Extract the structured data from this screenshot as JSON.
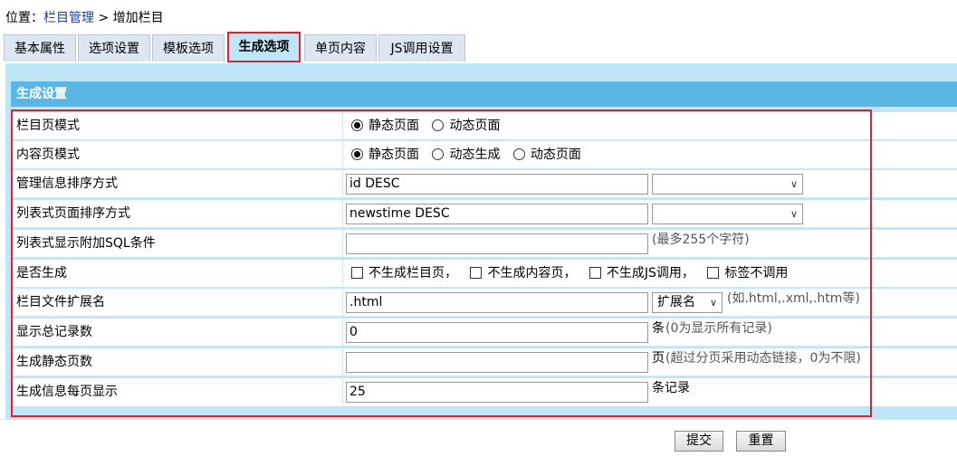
{
  "breadcrumb": {
    "prefix": "位置：",
    "link": "栏目管理",
    "sep": " > ",
    "current": "增加栏目"
  },
  "tabs": [
    "基本属性",
    "选项设置",
    "模板选项",
    "生成选项",
    "单页内容",
    "JS调用设置"
  ],
  "active_tab": "生成选项",
  "section_title": "生成设置",
  "rows": {
    "r0": {
      "label": "栏目页模式",
      "opts": [
        "静态页面",
        "动态页面"
      ],
      "selected": "静态页面"
    },
    "r1": {
      "label": "内容页模式",
      "opts": [
        "静态页面",
        "动态生成",
        "动态页面"
      ],
      "selected": "静态页面"
    },
    "r2": {
      "label": "管理信息排序方式",
      "value": "id DESC",
      "select": ""
    },
    "r3": {
      "label": "列表式页面排序方式",
      "value": "newstime DESC",
      "select": ""
    },
    "r4": {
      "label": "列表式显示附加SQL条件",
      "value": "",
      "hint": "(最多255个字符)"
    },
    "r5": {
      "label": "是否生成",
      "checks": [
        "不生成栏目页，",
        "不生成内容页，",
        "不生成JS调用，",
        "标签不调用"
      ]
    },
    "r6": {
      "label": "栏目文件扩展名",
      "value": ".html",
      "select": "扩展名",
      "hint": "(如.html,.xml,.htm等)"
    },
    "r7": {
      "label": "显示总记录数",
      "value": "0",
      "unit": "条",
      "hint": "(0为显示所有记录)"
    },
    "r8": {
      "label": "生成静态页数",
      "value": "",
      "unit": "页",
      "hint": "(超过分页采用动态链接，0为不限)"
    },
    "r9": {
      "label": "生成信息每页显示",
      "value": "25",
      "unit": "条记录"
    }
  },
  "buttons": {
    "submit": "提交",
    "reset": "重置"
  }
}
